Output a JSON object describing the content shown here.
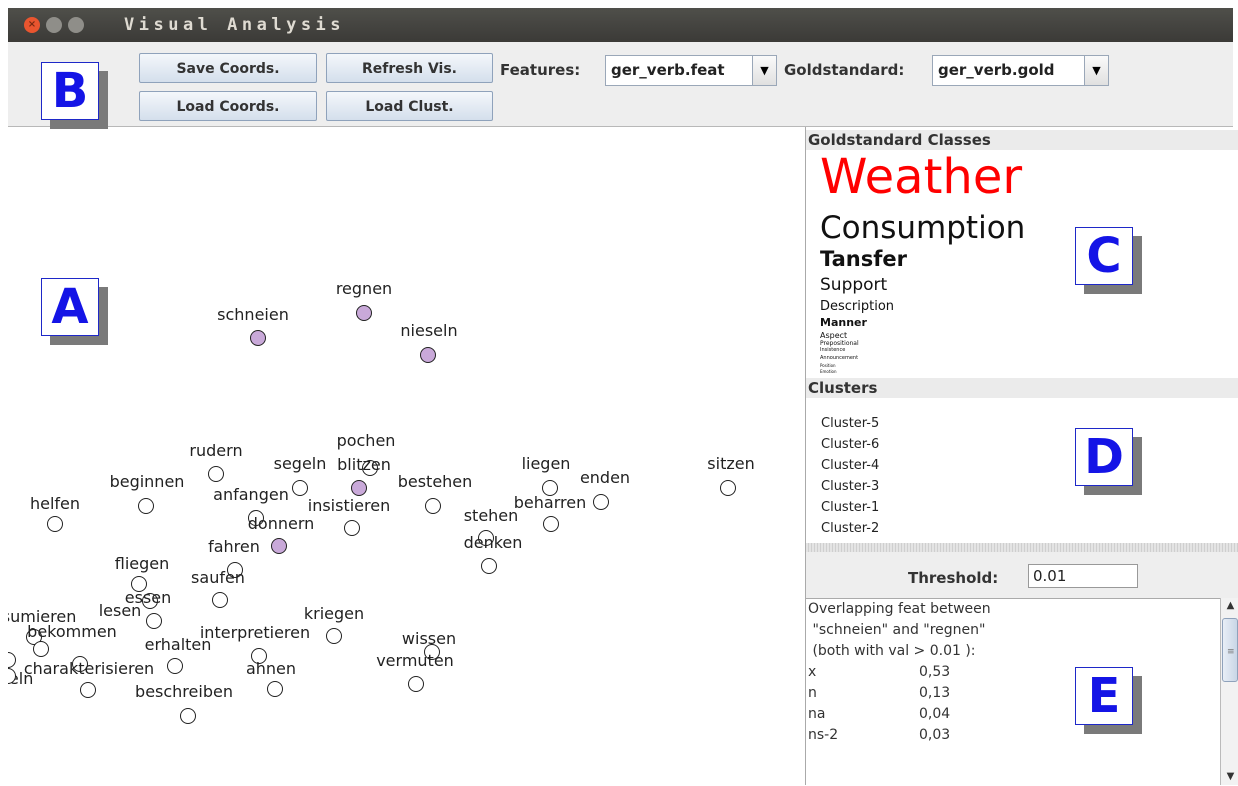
{
  "window": {
    "title": "Visual Analysis"
  },
  "toolbar": {
    "save_coords": "Save Coords.",
    "load_coords": "Load Coords.",
    "refresh_vis": "Refresh Vis.",
    "load_clust": "Load Clust.",
    "features_label": "Features:",
    "features_value": "ger_verb.feat",
    "gold_label": "Goldstandard:",
    "gold_value": "ger_verb.gold"
  },
  "annotations": {
    "a": "A",
    "b": "B",
    "c": "C",
    "d": "D",
    "e": "E"
  },
  "colors": {
    "highlight_node": "#c9a9d9",
    "weather_class": "#ff0000",
    "annotation_letter": "#1414e6"
  },
  "scatter": {
    "words": [
      {
        "label": "regnen",
        "highlight": true
      },
      {
        "label": "schneien",
        "highlight": true
      },
      {
        "label": "nieseln",
        "highlight": true
      },
      {
        "label": "pochen",
        "highlight": false
      },
      {
        "label": "rudern",
        "highlight": false
      },
      {
        "label": "segeln",
        "highlight": false
      },
      {
        "label": "blitzen",
        "highlight": true
      },
      {
        "label": "liegen",
        "highlight": false
      },
      {
        "label": "enden",
        "highlight": false
      },
      {
        "label": "sitzen",
        "highlight": false
      },
      {
        "label": "beginnen",
        "highlight": false
      },
      {
        "label": "anfangen",
        "highlight": false
      },
      {
        "label": "bestehen",
        "highlight": false
      },
      {
        "label": "helfen",
        "highlight": false
      },
      {
        "label": "insistieren",
        "highlight": false
      },
      {
        "label": "beharren",
        "highlight": false
      },
      {
        "label": "stehen",
        "highlight": false
      },
      {
        "label": "donnern",
        "highlight": true
      },
      {
        "label": "denken",
        "highlight": false
      },
      {
        "label": "fahren",
        "highlight": false
      },
      {
        "label": "fliegen",
        "highlight": false
      },
      {
        "label": "saufen",
        "highlight": false
      },
      {
        "label": "essen",
        "highlight": false
      },
      {
        "label": "lesen",
        "highlight": false
      },
      {
        "label": "nsumieren",
        "highlight": false
      },
      {
        "label": "kriegen",
        "highlight": false
      },
      {
        "label": "bekommen",
        "highlight": false
      },
      {
        "label": "interpretieren",
        "highlight": false
      },
      {
        "label": "wissen",
        "highlight": false
      },
      {
        "label": "erhalten",
        "highlight": false
      },
      {
        "label": "charakterisieren",
        "highlight": false
      },
      {
        "label": "ahnen",
        "highlight": false
      },
      {
        "label": "vermuten",
        "highlight": false
      },
      {
        "label": "teln",
        "highlight": false
      },
      {
        "label": "beschreiben",
        "highlight": false
      },
      {
        "label": "",
        "highlight": false
      },
      {
        "label": "",
        "highlight": false
      }
    ]
  },
  "goldstandard": {
    "header": "Goldstandard Classes",
    "classes": [
      {
        "label": "Weather",
        "color": "#ff0000"
      },
      {
        "label": "Consumption",
        "color": "#111111"
      },
      {
        "label": "Tansfer",
        "color": "#111111"
      },
      {
        "label": "Support",
        "color": "#111111"
      },
      {
        "label": "Description",
        "color": "#111111"
      },
      {
        "label": "Manner",
        "color": "#111111"
      },
      {
        "label": "Aspect",
        "color": "#111111"
      },
      {
        "label": "Prepositional",
        "color": "#111111"
      },
      {
        "label": "Insistence",
        "color": "#111111"
      },
      {
        "label": "Announcement",
        "color": "#111111"
      },
      {
        "label": "Position",
        "color": "#111111"
      },
      {
        "label": "Emotion",
        "color": "#111111"
      }
    ]
  },
  "clusters": {
    "header": "Clusters",
    "items": [
      "Cluster-5",
      "Cluster-6",
      "Cluster-4",
      "Cluster-3",
      "Cluster-1",
      "Cluster-2"
    ]
  },
  "threshold": {
    "label": "Threshold:",
    "value": "0.01"
  },
  "info": {
    "lines": [
      "Overlapping feat between",
      " \"schneien\" and \"regnen\"",
      " (both with val > 0.01 ):"
    ],
    "rows": [
      {
        "name": "x",
        "value": "0,53"
      },
      {
        "name": "n",
        "value": "0,13"
      },
      {
        "name": "na",
        "value": "0,04"
      },
      {
        "name": "ns-2",
        "value": "0,03"
      }
    ]
  }
}
